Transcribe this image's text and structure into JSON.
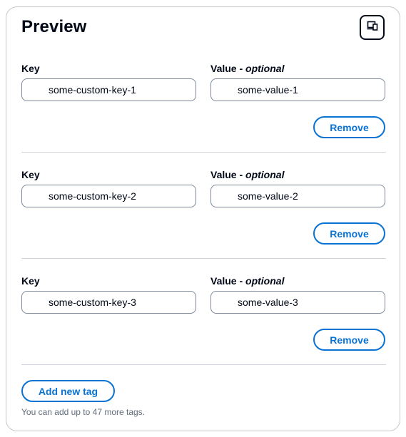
{
  "header": {
    "title": "Preview",
    "icon": "preview-window-icon"
  },
  "labels": {
    "key": "Key",
    "value": "Value - ",
    "optional": "optional"
  },
  "tags": [
    {
      "key": "some-custom-key-1",
      "value": "some-value-1",
      "remove_label": "Remove"
    },
    {
      "key": "some-custom-key-2",
      "value": "some-value-2",
      "remove_label": "Remove"
    },
    {
      "key": "some-custom-key-3",
      "value": "some-value-3",
      "remove_label": "Remove"
    }
  ],
  "footer": {
    "add_label": "Add new tag",
    "hint": "You can add up to 47 more tags."
  },
  "colors": {
    "accent": "#0972d3",
    "text": "#000716",
    "border": "#7d8998",
    "muted": "#5f6b7a"
  }
}
